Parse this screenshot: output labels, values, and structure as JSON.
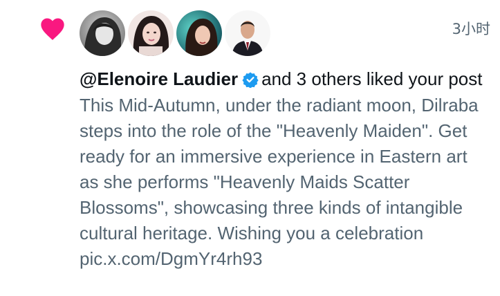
{
  "notification": {
    "type_icon": "heart-icon",
    "accent_color": "#f91880",
    "verified_color": "#1d9bf0",
    "timestamp": "3小时",
    "avatars": [
      {
        "icon": "avatar-photo",
        "tone": "grayscale"
      },
      {
        "icon": "avatar-photo",
        "tone": "portrait"
      },
      {
        "icon": "avatar-photo",
        "tone": "teal"
      },
      {
        "icon": "avatar-photo",
        "tone": "suit"
      }
    ],
    "username": "@Elenoire Laudier",
    "verified": true,
    "action_text": "and 3 others liked your post",
    "post_preview": "This Mid-Autumn, under the radiant moon, Dilraba steps into the role of the \"Heavenly Maiden\". Get ready for an immersive experience in Eastern art as she performs \"Heavenly Maids Scatter Blossoms\", showcasing three kinds of intangible cultural heritage. Wishing you a celebration pic.x.com/DgmYr4rh93"
  }
}
